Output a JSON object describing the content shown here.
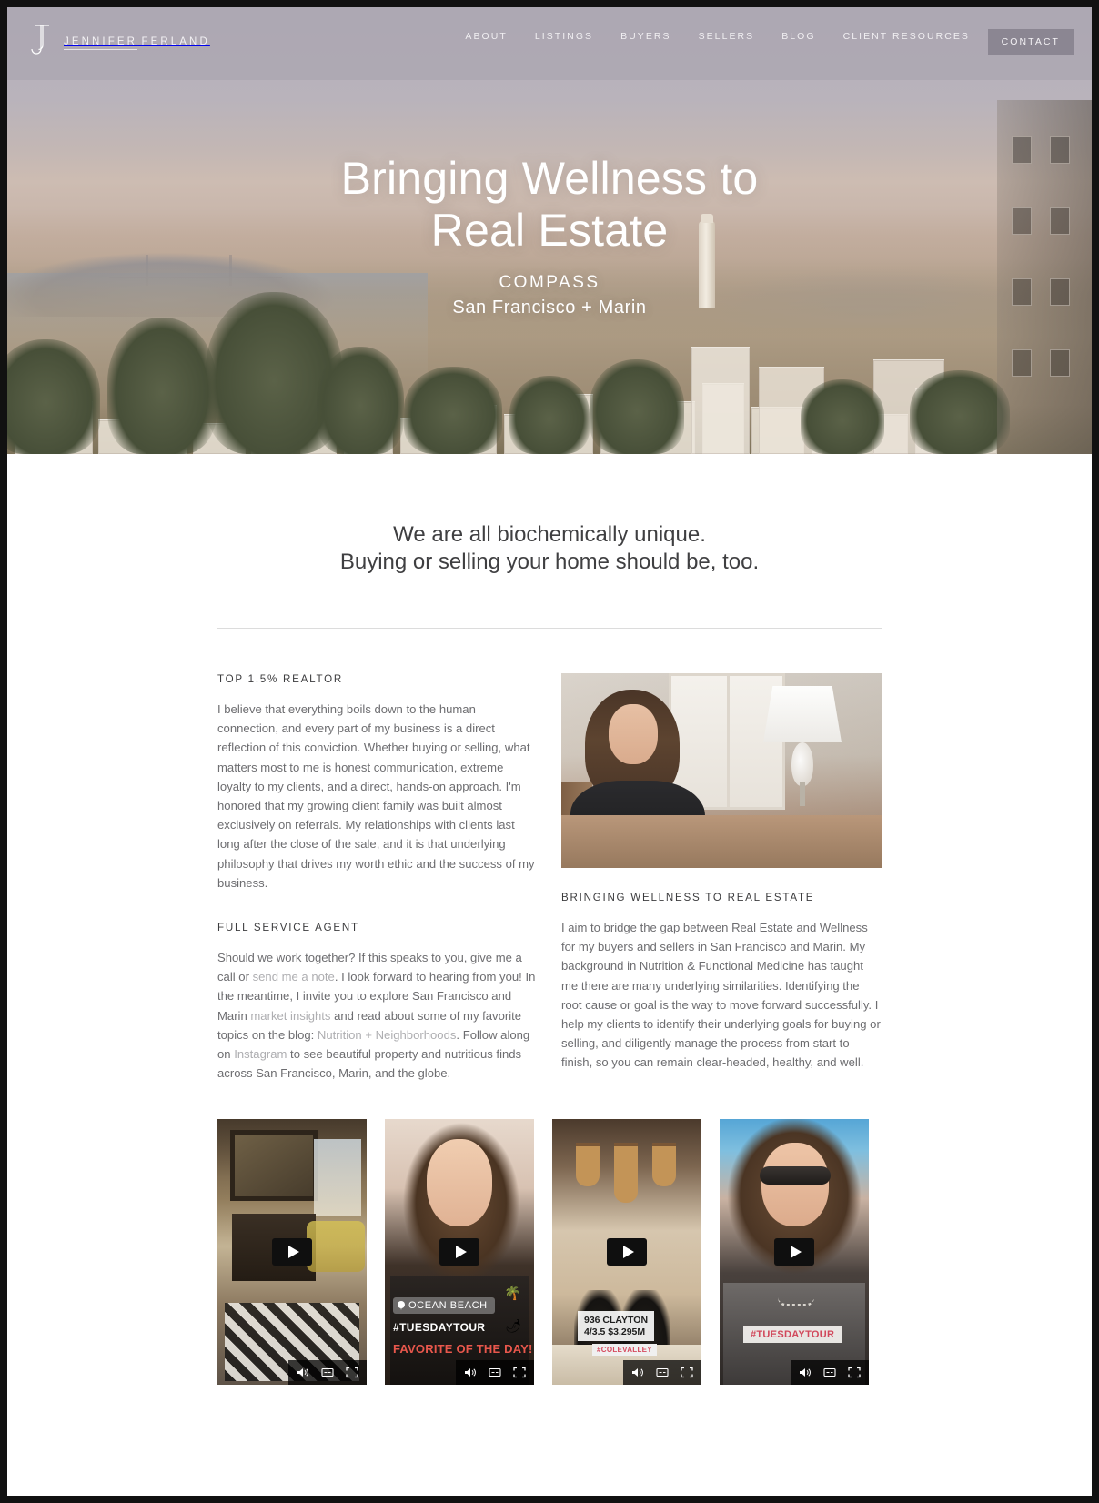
{
  "brand": {
    "monogram": "JJ",
    "line1": "JENNIFER",
    "line2": "FERLAND"
  },
  "nav": {
    "items": [
      {
        "label": "ABOUT"
      },
      {
        "label": "LISTINGS"
      },
      {
        "label": "BUYERS"
      },
      {
        "label": "SELLERS"
      },
      {
        "label": "BLOG"
      },
      {
        "label": "CLIENT RESOURCES"
      }
    ],
    "contact_label": "CONTACT",
    "contact_bg": "#88838f"
  },
  "hero": {
    "title_line1": "Bringing Wellness to",
    "title_line2": "Real Estate",
    "subtitle_1": "COMPASS",
    "subtitle_2": "San Francisco + Marin",
    "overlay_color": "#aba6b2"
  },
  "tagline": {
    "line1": "We are all biochemically unique.",
    "line2": "Buying or selling your home should be, too."
  },
  "left_column": {
    "kicker_1": "TOP 1.5% REALTOR",
    "paragraph_1": "I believe that everything boils down to the human connection, and every part of my business is a direct reflection of this conviction. Whether buying or selling, what matters most to me is honest communication, extreme loyalty to my clients, and a direct, hands-on approach. I'm honored that my growing client family was built almost exclusively on referrals. My relationships with clients last long after the close of the sale, and it is that underlying philosophy that drives my worth ethic and the success of my business.",
    "kicker_2": "FULL SERVICE AGENT",
    "paragraph_2_a": "Should we work together? If this speaks to you, give me a call or ",
    "link_note": "send me a note",
    "paragraph_2_b": ". I look forward to hearing from you! In the meantime, I invite you to explore San Francisco and Marin ",
    "link_market": "market insights",
    "paragraph_2_c": " and read about some of my favorite topics on the blog: ",
    "link_blog": "Nutrition + Neighborhoods",
    "paragraph_2_d": ". Follow along on ",
    "link_instagram": "Instagram",
    "paragraph_2_e": " to see beautiful property and nutritious finds across San Francisco, Marin, and the globe."
  },
  "right_column": {
    "image_alt": "headshot-photo",
    "kicker": "BRINGING WELLNESS TO REAL ESTATE",
    "paragraph": "I aim to bridge the gap between Real Estate and Wellness for my buyers and sellers in San Francisco and Marin. My background in Nutrition & Functional Medicine has taught me there are many underlying similarities. Identifying the root cause or goal is the way to move forward successfully. I help my clients to identify their underlying goals for buying or selling, and diligently manage the process from start to finish, so you can remain clear-headed, healthy, and well."
  },
  "videos": [
    {
      "id": "video-1",
      "alt": "living-room-interior-video",
      "overlays": {}
    },
    {
      "id": "video-2",
      "alt": "agent-selfie-video",
      "overlays": {
        "location": "OCEAN BEACH",
        "hashtag": "#TUESDAYTOUR",
        "favorite": "FAVORITE OF THE DAY!"
      }
    },
    {
      "id": "video-3",
      "alt": "kitchen-pendant-lights-video",
      "overlays": {
        "address_line1": "936 CLAYTON",
        "address_line2": "4/3.5 $3.295M",
        "neighborhood": "#COLEVALLEY"
      }
    },
    {
      "id": "video-4",
      "alt": "agent-sunglasses-video",
      "overlays": {
        "hashtag": "#TUESDAYTOUR"
      }
    }
  ],
  "video_controls": {
    "volume": "volume-icon",
    "captions": "captions-icon",
    "fullscreen": "fullscreen-icon",
    "play": "play-icon"
  }
}
